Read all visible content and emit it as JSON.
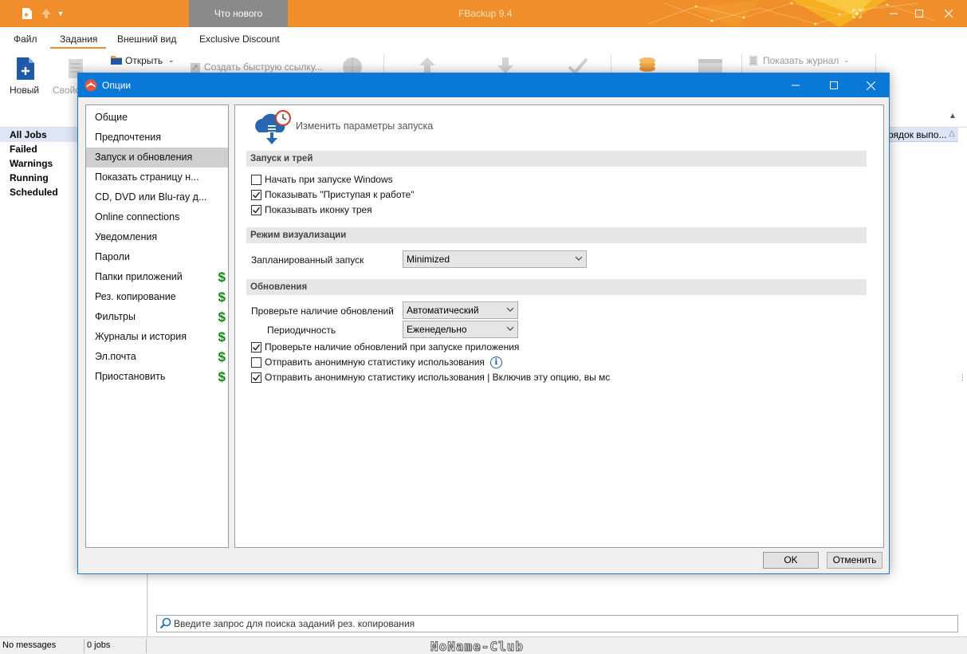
{
  "app": {
    "title": "FBackup 9.4",
    "whats_new": "Что нового"
  },
  "menu": {
    "items": [
      "Файл",
      "Задания",
      "Внешний вид",
      "Exclusive Discount"
    ]
  },
  "ribbon": {
    "new_label": "Новый",
    "properties_label": "Свойс",
    "open_label": "Открыть",
    "shortcut_label": "Создать быструю ссылку...",
    "show_log_label": "Показать журнал"
  },
  "nav": {
    "items": [
      "All Jobs",
      "Failed",
      "Warnings",
      "Running",
      "Scheduled"
    ]
  },
  "list": {
    "column_header": "рядок выпо..."
  },
  "search": {
    "placeholder": "Введите запрос для поиска заданий рез. копирования"
  },
  "status": {
    "messages": "No messages",
    "jobs": "0 jobs",
    "watermark": "NoName-Club"
  },
  "dialog": {
    "title": "Опции",
    "categories": [
      {
        "label": "Общие",
        "premium": false
      },
      {
        "label": "Предпочтения",
        "premium": false
      },
      {
        "label": "Запуск и обновления",
        "premium": false
      },
      {
        "label": "Показать страницу н...",
        "premium": false
      },
      {
        "label": "CD, DVD или Blu-ray д...",
        "premium": false
      },
      {
        "label": "Online connections",
        "premium": false
      },
      {
        "label": "Уведомления",
        "premium": false
      },
      {
        "label": "Пароли",
        "premium": false
      },
      {
        "label": "Папки приложений",
        "premium": true
      },
      {
        "label": "Рез. копирование",
        "premium": true
      },
      {
        "label": "Фильтры",
        "premium": true
      },
      {
        "label": "Журналы и история",
        "premium": true
      },
      {
        "label": "Эл.почта",
        "premium": true
      },
      {
        "label": "Приостановить",
        "premium": true
      }
    ],
    "dollar_symbol": "$",
    "selected_category": "Запуск и обновления",
    "header_text": "Изменить параметры запуска",
    "sections": {
      "startup_tray": "Запуск и трей",
      "view_mode": "Режим визуализации",
      "updates": "Обновления"
    },
    "checkboxes": {
      "start_with_windows": {
        "label": "Начать при запуске Windows",
        "checked": false
      },
      "show_getting_started": {
        "label": "Показывать \"Приступая к работе\"",
        "checked": true
      },
      "show_tray_icon": {
        "label": "Показывать иконку трея",
        "checked": true
      },
      "check_on_startup": {
        "label": "Проверьте наличие обновлений при запуске приложения",
        "checked": true
      },
      "anon_stats": {
        "label": "Отправить анонимную статистику использования",
        "checked": false
      },
      "anon_stats_2": {
        "label": "Отправить анонимную статистику использования | Включив эту опцию, вы мс",
        "checked": true
      }
    },
    "fields": {
      "scheduled_run_label": "Запланированный запуск",
      "scheduled_run_value": "Minimized",
      "check_updates_label": "Проверьте наличие обновлений",
      "check_updates_value": "Автоматический",
      "frequency_label": "Периодичность",
      "frequency_value": "Еженедельно"
    },
    "ok_label": "OK",
    "cancel_label": "Отменить"
  },
  "colors": {
    "accent_orange": "#ef8e2a",
    "dialog_blue": "#0a78d7",
    "premium_green": "#108a10"
  }
}
